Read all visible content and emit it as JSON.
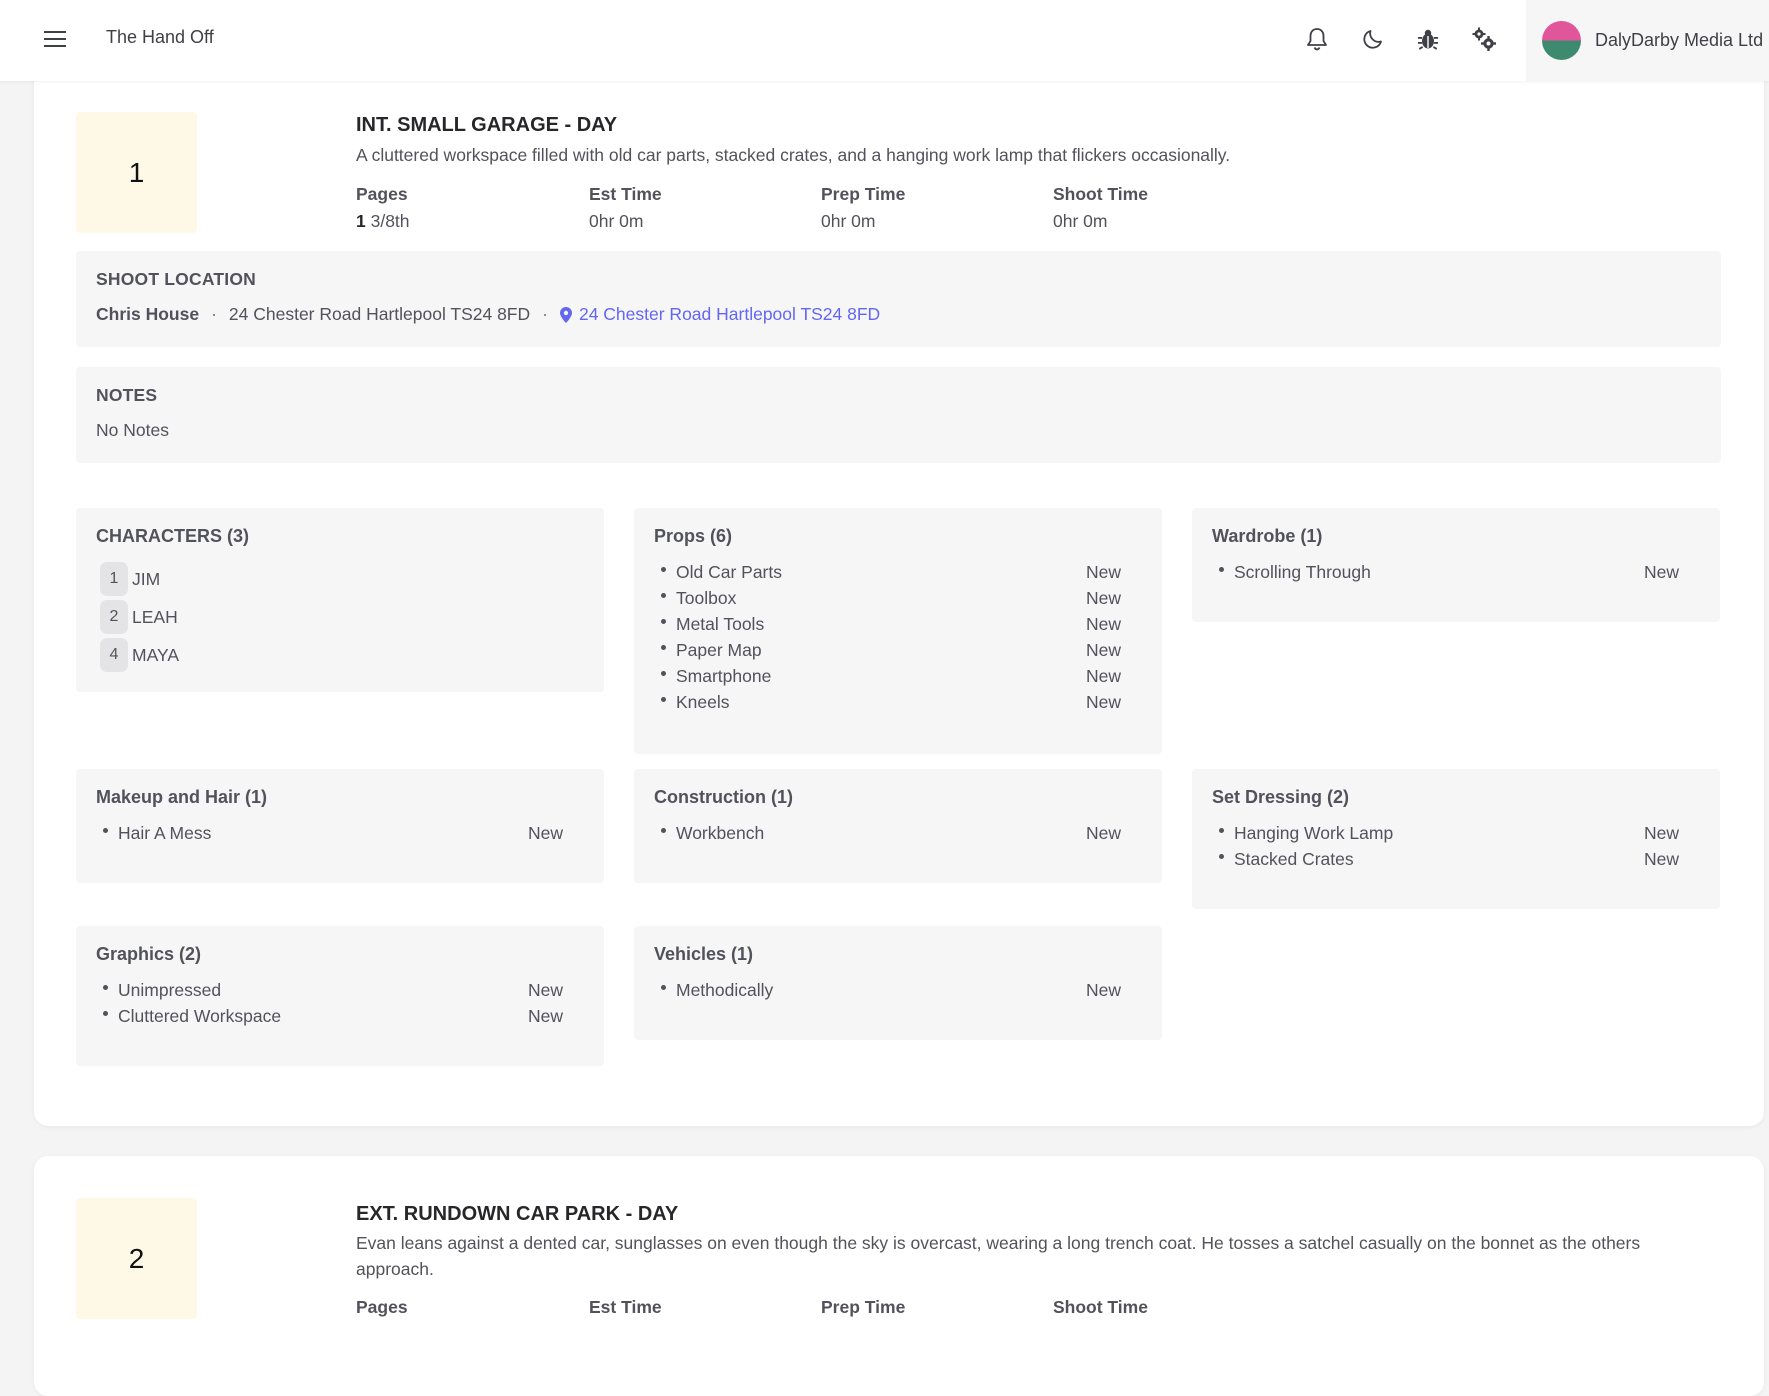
{
  "header": {
    "app_title": "The Hand Off",
    "account_name": "DalyDarby Media Ltd",
    "icons": [
      "menu-icon",
      "bell-icon",
      "moon-icon",
      "bug-icon",
      "gears-icon"
    ]
  },
  "colors": {
    "page_bg": "#f4f4f5",
    "scene_number_bg": "#fef9e7",
    "link": "#6366f1",
    "panel_bg": "#f6f6f7",
    "avatar_top": "#e1559a",
    "avatar_bottom": "#3e8a6e"
  },
  "scenes": [
    {
      "number": "1",
      "heading": "INT. SMALL GARAGE - DAY",
      "description": "A cluttered workspace filled with old car parts, stacked crates, and a hanging work lamp that flickers occasionally.",
      "stats": {
        "pages_label": "Pages",
        "pages_whole": "1",
        "pages_fraction": "3/8th",
        "est_label": "Est Time",
        "est_value": "0hr 0m",
        "prep_label": "Prep Time",
        "prep_value": "0hr 0m",
        "shoot_label": "Shoot Time",
        "shoot_value": "0hr 0m"
      },
      "location": {
        "title": "SHOOT LOCATION",
        "name": "Chris House",
        "address": "24 Chester Road Hartlepool TS24 8FD",
        "map_link": "24 Chester Road Hartlepool TS24 8FD"
      },
      "notes": {
        "title": "NOTES",
        "text": "No Notes"
      },
      "characters": {
        "title": "CHARACTERS (3)",
        "items": [
          {
            "id": "1",
            "name": "JIM"
          },
          {
            "id": "2",
            "name": "LEAH"
          },
          {
            "id": "4",
            "name": "MAYA"
          }
        ]
      },
      "props": {
        "title": "Props (6)",
        "items": [
          {
            "name": "Old Car Parts",
            "status": "New"
          },
          {
            "name": "Toolbox",
            "status": "New"
          },
          {
            "name": "Metal Tools",
            "status": "New"
          },
          {
            "name": "Paper Map",
            "status": "New"
          },
          {
            "name": "Smartphone",
            "status": "New"
          },
          {
            "name": "Kneels",
            "status": "New"
          }
        ]
      },
      "wardrobe": {
        "title": "Wardrobe (1)",
        "items": [
          {
            "name": "Scrolling Through",
            "status": "New"
          }
        ]
      },
      "makeup": {
        "title": "Makeup and Hair (1)",
        "items": [
          {
            "name": "Hair A Mess",
            "status": "New"
          }
        ]
      },
      "construction": {
        "title": "Construction (1)",
        "items": [
          {
            "name": "Workbench",
            "status": "New"
          }
        ]
      },
      "set_dressing": {
        "title": "Set Dressing (2)",
        "items": [
          {
            "name": "Hanging Work Lamp",
            "status": "New"
          },
          {
            "name": "Stacked Crates",
            "status": "New"
          }
        ]
      },
      "graphics": {
        "title": "Graphics (2)",
        "items": [
          {
            "name": "Unimpressed",
            "status": "New"
          },
          {
            "name": "Cluttered Workspace",
            "status": "New"
          }
        ]
      },
      "vehicles": {
        "title": "Vehicles (1)",
        "items": [
          {
            "name": "Methodically",
            "status": "New"
          }
        ]
      }
    },
    {
      "number": "2",
      "heading": "EXT. RUNDOWN CAR PARK - DAY",
      "description": "Evan leans against a dented car, sunglasses on even though the sky is overcast, wearing a long trench coat. He tosses a satchel casually on the bonnet as the others approach.",
      "stats": {
        "pages_label": "Pages",
        "est_label": "Est Time",
        "prep_label": "Prep Time",
        "shoot_label": "Shoot Time"
      }
    }
  ]
}
